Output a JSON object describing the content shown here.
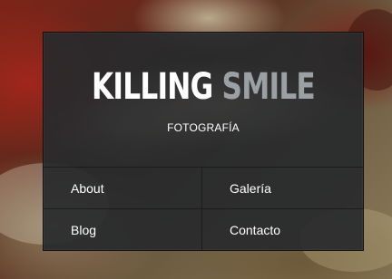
{
  "site": {
    "logo_word1": "KILLING",
    "logo_word2": "SMILE",
    "tagline": "FOTOGRAFÍA"
  },
  "nav": {
    "items": [
      {
        "label": "About"
      },
      {
        "label": "Galería"
      },
      {
        "label": "Blog"
      },
      {
        "label": "Contacto"
      }
    ]
  },
  "colors": {
    "logo_word1": "#ffffff",
    "logo_word2": "#9aa0a3",
    "panel_background": "#2a2c2e"
  }
}
